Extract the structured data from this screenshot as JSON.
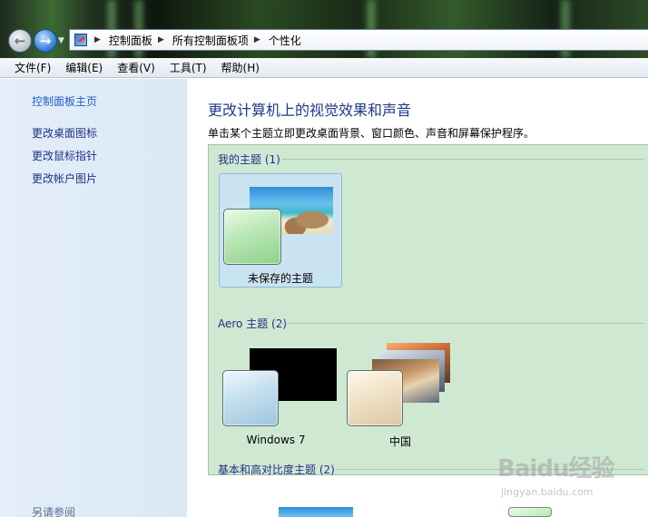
{
  "breadcrumbs": [
    "控制面板",
    "所有控制面板项",
    "个性化"
  ],
  "menu": [
    "文件(F)",
    "编辑(E)",
    "查看(V)",
    "工具(T)",
    "帮助(H)"
  ],
  "sidebar": {
    "home_link": "控制面板主页",
    "links": [
      "更改桌面图标",
      "更改鼠标指针",
      "更改帐户图片"
    ],
    "see_also": "另请参阅"
  },
  "main": {
    "title": "更改计算机上的视觉效果和声音",
    "description": "单击某个主题立即更改桌面背景、窗口颜色、声音和屏幕保护程序。"
  },
  "theme_groups": {
    "my_themes": {
      "header": "我的主题 (1)",
      "themes": [
        {
          "label": "未保存的主题",
          "selected": true
        }
      ]
    },
    "aero_themes": {
      "header": "Aero 主题 (2)",
      "themes": [
        {
          "label": "Windows 7"
        },
        {
          "label": "中国"
        }
      ]
    },
    "basic_themes": {
      "header": "基本和高对比度主题 (2)"
    }
  },
  "watermark": {
    "brand": "Baidu经验",
    "url": "jingyan.baidu.com"
  },
  "colors": {
    "highlight_box": "#e8201a",
    "link": "#1e3287",
    "panel_bg": "#cfe8d2"
  }
}
